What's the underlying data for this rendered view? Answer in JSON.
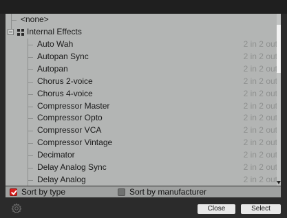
{
  "tree": {
    "none_label": "<none>",
    "group_label": "Internal Effects",
    "items": [
      {
        "name": "Auto Wah",
        "io": "2 in 2 out"
      },
      {
        "name": "Autopan Sync",
        "io": "2 in 2 out"
      },
      {
        "name": "Autopan",
        "io": "2 in 2 out"
      },
      {
        "name": "Chorus 2-voice",
        "io": "2 in 2 out"
      },
      {
        "name": "Chorus 4-voice",
        "io": "2 in 2 out"
      },
      {
        "name": "Compressor Master",
        "io": "2 in 2 out"
      },
      {
        "name": "Compressor Opto",
        "io": "2 in 2 out"
      },
      {
        "name": "Compressor VCA",
        "io": "2 in 2 out"
      },
      {
        "name": "Compressor Vintage",
        "io": "2 in 2 out"
      },
      {
        "name": "Decimator",
        "io": "2 in 2 out"
      },
      {
        "name": "Delay Analog Sync",
        "io": "2 in 2 out"
      },
      {
        "name": "Delay Analog",
        "io": "2 in 2 out"
      }
    ]
  },
  "sort": {
    "by_type": {
      "label": "Sort by type",
      "checked": true
    },
    "by_manufacturer": {
      "label": "Sort by manufacturer",
      "checked": false
    }
  },
  "footer": {
    "close_label": "Close",
    "select_label": "Select",
    "settings_icon": "gear-icon"
  },
  "colors": {
    "checkbox_checked": "#d8201f",
    "io_text": "#8f9190",
    "list_background": "#b3b5b4"
  }
}
